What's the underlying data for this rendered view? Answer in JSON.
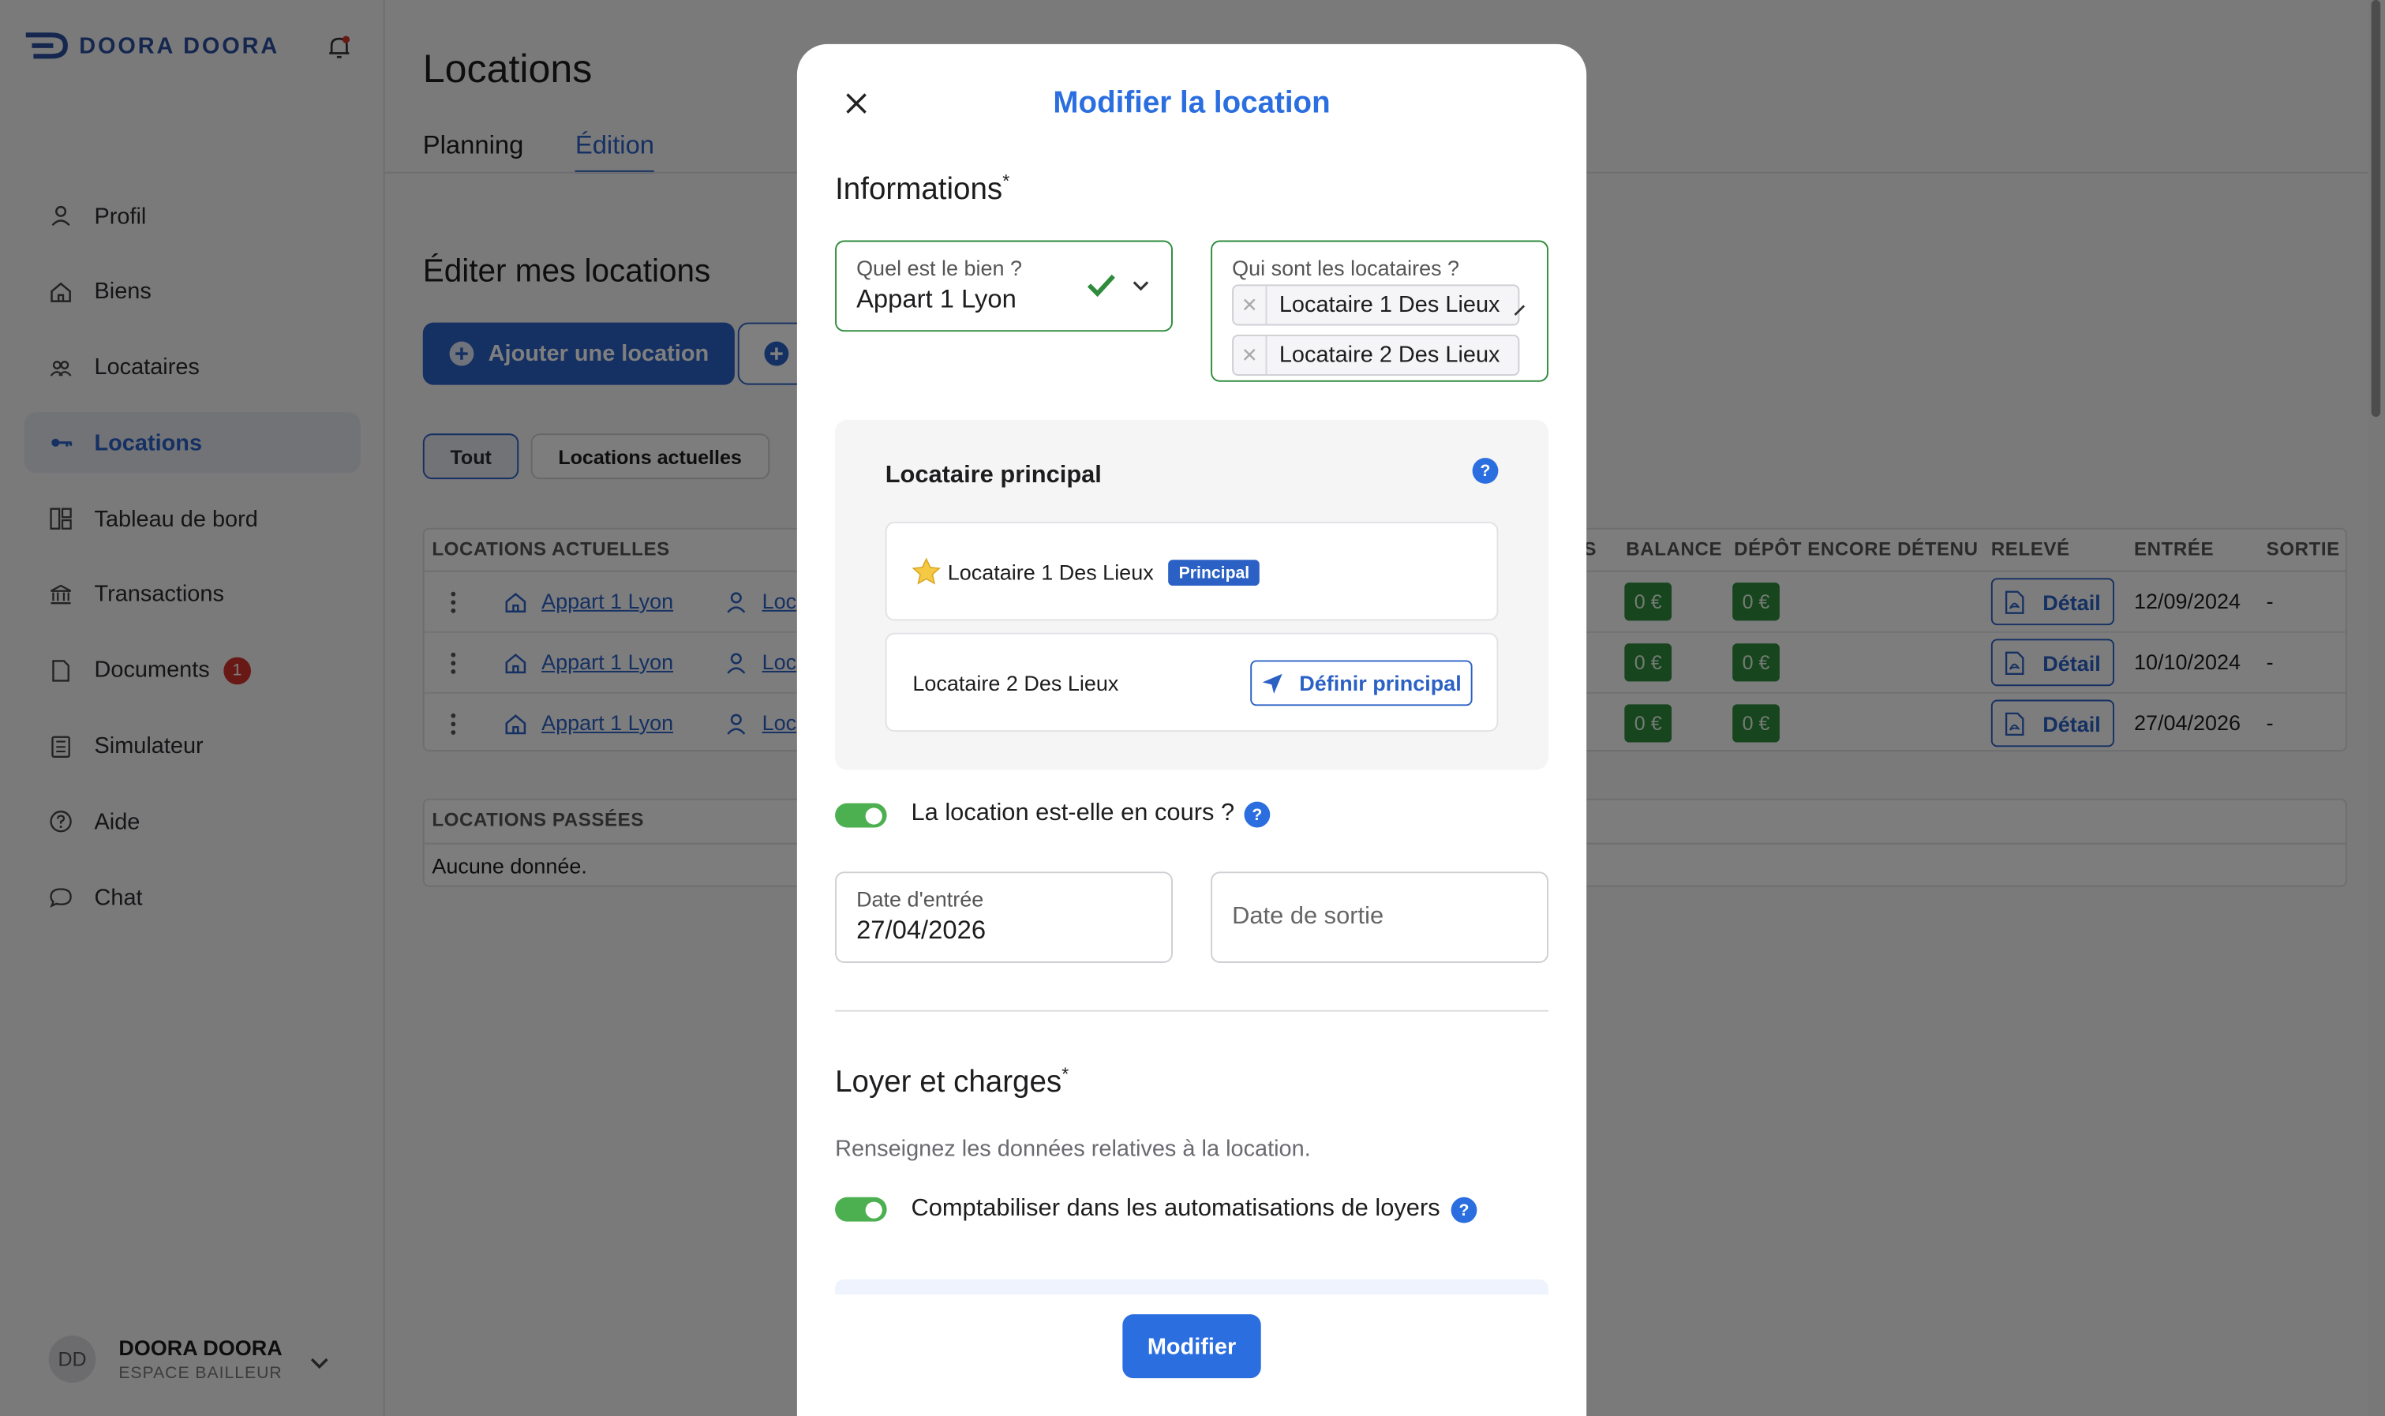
{
  "brand": {
    "name": "DOORA DOORA"
  },
  "sidebar": {
    "items": [
      {
        "label": "Profil"
      },
      {
        "label": "Biens"
      },
      {
        "label": "Locataires"
      },
      {
        "label": "Locations"
      },
      {
        "label": "Tableau de bord"
      },
      {
        "label": "Transactions"
      },
      {
        "label": "Documents",
        "badge": "1"
      },
      {
        "label": "Simulateur"
      },
      {
        "label": "Aide"
      },
      {
        "label": "Chat"
      }
    ],
    "active_item": "Locations"
  },
  "user": {
    "initials": "DD",
    "name": "DOORA DOORA",
    "role": "ESPACE BAILLEUR"
  },
  "page": {
    "title": "Locations",
    "tabs": [
      {
        "label": "Planning"
      },
      {
        "label": "Édition"
      }
    ],
    "active_tab": "Édition",
    "section_title": "Éditer mes locations",
    "add_button": "Ajouter une location",
    "filters": [
      {
        "label": "Tout"
      },
      {
        "label": "Locations actuelles"
      }
    ],
    "current_table": {
      "title": "LOCATIONS ACTUELLES",
      "headers": {
        "col_s": "S",
        "balance": "BALANCE",
        "depot": "DÉPÔT ENCORE DÉTENU",
        "releve": "RELEVÉ",
        "entree": "ENTRÉE",
        "sortie": "SORTIE"
      },
      "rows": [
        {
          "bien": "Appart 1 Lyon",
          "locataire": "Loc",
          "balance": "0 €",
          "depot": "0 €",
          "releve": "Détail",
          "entree": "12/09/2024",
          "sortie": "-"
        },
        {
          "bien": "Appart 1 Lyon",
          "locataire": "Loc",
          "balance": "0 €",
          "depot": "0 €",
          "releve": "Détail",
          "entree": "10/10/2024",
          "sortie": "-"
        },
        {
          "bien": "Appart 1 Lyon",
          "locataire": "Loc",
          "balance": "0 €",
          "depot": "0 €",
          "releve": "Détail",
          "entree": "27/04/2026",
          "sortie": "-"
        }
      ]
    },
    "past_table": {
      "title": "LOCATIONS PASSÉES",
      "empty": "Aucune donnée."
    }
  },
  "modal": {
    "title": "Modifier la location",
    "informations": "Informations",
    "required_mark": "*",
    "bien_label": "Quel est le bien ?",
    "bien_value": "Appart 1 Lyon",
    "locataires_label": "Qui sont les locataires ?",
    "locataires": [
      "Locataire 1 Des Lieux",
      "Locataire 2 Des Lieux"
    ],
    "principal_title": "Locataire principal",
    "principal_name": "Locataire 1 Des Lieux",
    "principal_pill": "Principal",
    "other_name": "Locataire 2 Des Lieux",
    "define_principal": "Définir principal",
    "help_glyph": "?",
    "en_cours_label": "La location est-elle en cours ?",
    "en_cours_value": true,
    "date_entree_label": "Date d'entrée",
    "date_entree_value": "27/04/2026",
    "date_sortie_placeholder": "Date de sortie",
    "loyer_title": "Loyer et charges",
    "loyer_desc": "Renseignez les données relatives à la location.",
    "automatisation_label": "Comptabiliser dans les automatisations de loyers",
    "automatisation_value": true,
    "submit": "Modifier"
  },
  "colors": {
    "accent": "#2b61c4",
    "title_blue": "#2b6ee0",
    "success": "#2e8b3c",
    "toggle_on": "#4caf50",
    "danger": "#d0322b"
  },
  "icons": [
    "doora-logo",
    "bell-icon",
    "user-icon",
    "home-icon",
    "users-icon",
    "key-icon",
    "dashboard-icon",
    "bank-icon",
    "document-icon",
    "calculator-icon",
    "help-circle-icon",
    "chat-icon",
    "chevron-down-icon",
    "plus-circle-icon",
    "kebab-icon",
    "pdf-icon",
    "close-icon",
    "check-icon",
    "star-icon",
    "send-icon"
  ]
}
